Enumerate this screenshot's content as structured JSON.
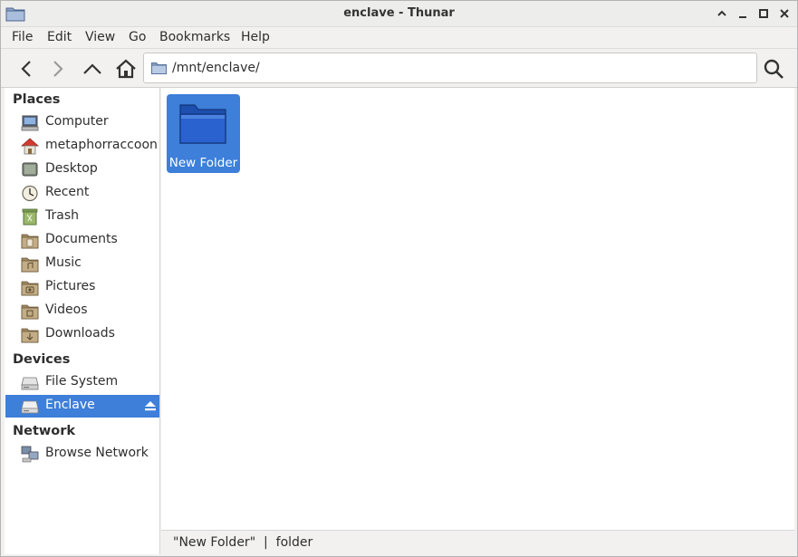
{
  "window": {
    "title": "enclave - Thunar",
    "app_icon": "folder-icon",
    "controls": [
      "maximize-up-icon",
      "minimize-icon",
      "restore-icon",
      "close-icon"
    ]
  },
  "menubar": {
    "items": [
      "File",
      "Edit",
      "View",
      "Go",
      "Bookmarks",
      "Help"
    ]
  },
  "toolbar": {
    "back_icon": "back-arrow-icon",
    "forward_icon": "forward-arrow-icon",
    "up_icon": "up-arrow-icon",
    "home_icon": "home-icon",
    "location": "/mnt/enclave/",
    "search_icon": "search-icon"
  },
  "sidebar": {
    "places_heading": "Places",
    "places": [
      {
        "label": "Computer",
        "icon": "computer-icon"
      },
      {
        "label": "metaphorraccoon",
        "icon": "home-icon"
      },
      {
        "label": "Desktop",
        "icon": "desktop-icon"
      },
      {
        "label": "Recent",
        "icon": "clock-icon"
      },
      {
        "label": "Trash",
        "icon": "trash-icon"
      },
      {
        "label": "Documents",
        "icon": "documents-folder-icon"
      },
      {
        "label": "Music",
        "icon": "music-folder-icon"
      },
      {
        "label": "Pictures",
        "icon": "pictures-folder-icon"
      },
      {
        "label": "Videos",
        "icon": "videos-folder-icon"
      },
      {
        "label": "Downloads",
        "icon": "downloads-folder-icon"
      }
    ],
    "devices_heading": "Devices",
    "devices": [
      {
        "label": "File System",
        "icon": "drive-icon"
      },
      {
        "label": "Enclave",
        "icon": "drive-icon",
        "selected": true,
        "eject_icon": "eject-icon"
      }
    ],
    "network_heading": "Network",
    "network": [
      {
        "label": "Browse Network",
        "icon": "network-icon"
      }
    ]
  },
  "main": {
    "files": [
      {
        "name": "New Folder",
        "icon": "folder-icon",
        "selected": true
      }
    ]
  },
  "statusbar": {
    "text": "\"New Folder\"  |  folder"
  },
  "colors": {
    "selection": "#3d7fd9",
    "folder": "#2a5fc6"
  }
}
